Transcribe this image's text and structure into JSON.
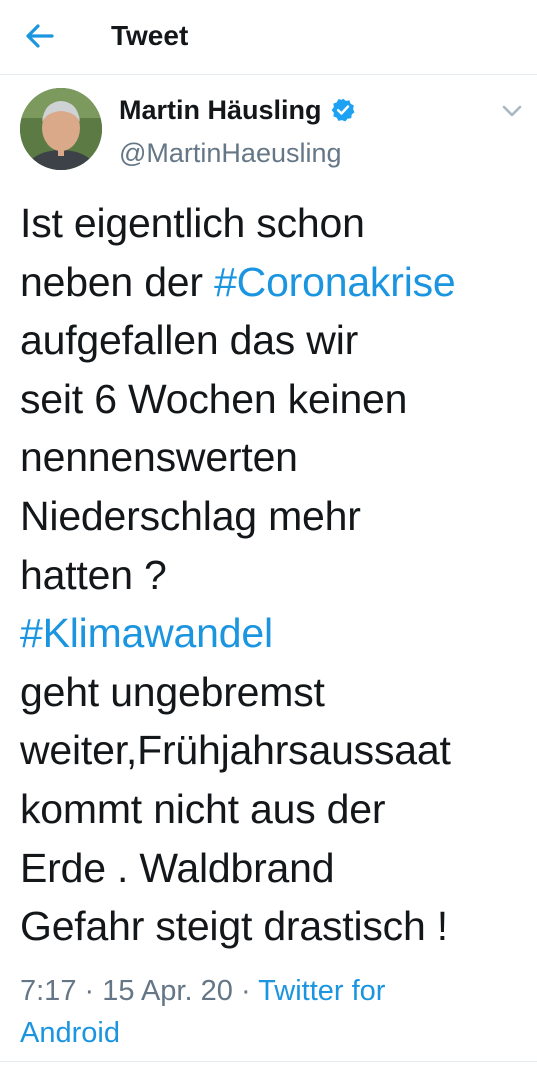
{
  "header": {
    "title": "Tweet",
    "back_icon": "back-arrow-icon"
  },
  "author": {
    "name": "Martin Häusling",
    "handle": "@MartinHaeusling",
    "verified": true
  },
  "tweet": {
    "lines": [
      [
        {
          "t": "Ist eigentlich schon",
          "tag": false
        }
      ],
      [
        {
          "t": "neben der ",
          "tag": false
        },
        {
          "t": "#Coronakrise",
          "tag": true
        }
      ],
      [
        {
          "t": "aufgefallen das wir",
          "tag": false
        }
      ],
      [
        {
          "t": "seit 6 Wochen keinen",
          "tag": false
        }
      ],
      [
        {
          "t": "nennenswerten",
          "tag": false
        }
      ],
      [
        {
          "t": "Niederschlag mehr",
          "tag": false
        }
      ],
      [
        {
          "t": "hatten ?",
          "tag": false
        }
      ],
      [
        {
          "t": "#Klimawandel",
          "tag": true
        }
      ],
      [
        {
          "t": "geht ungebremst",
          "tag": false
        }
      ],
      [
        {
          "t": "weiter,Frühjahrsaussaat",
          "tag": false
        }
      ],
      [
        {
          "t": "kommt nicht aus der",
          "tag": false
        }
      ],
      [
        {
          "t": "Erde . Waldbrand",
          "tag": false
        }
      ],
      [
        {
          "t": "Gefahr steigt drastisch !",
          "tag": false
        }
      ]
    ]
  },
  "meta": {
    "time": "7:17",
    "separator": "·",
    "date": "15 Apr. 20",
    "source_line1": "Twitter for",
    "source_line2": "Android"
  },
  "colors": {
    "link": "#1b95e0",
    "secondary_text": "#657786",
    "primary_text": "#14171a",
    "divider": "#e6ecf0"
  }
}
